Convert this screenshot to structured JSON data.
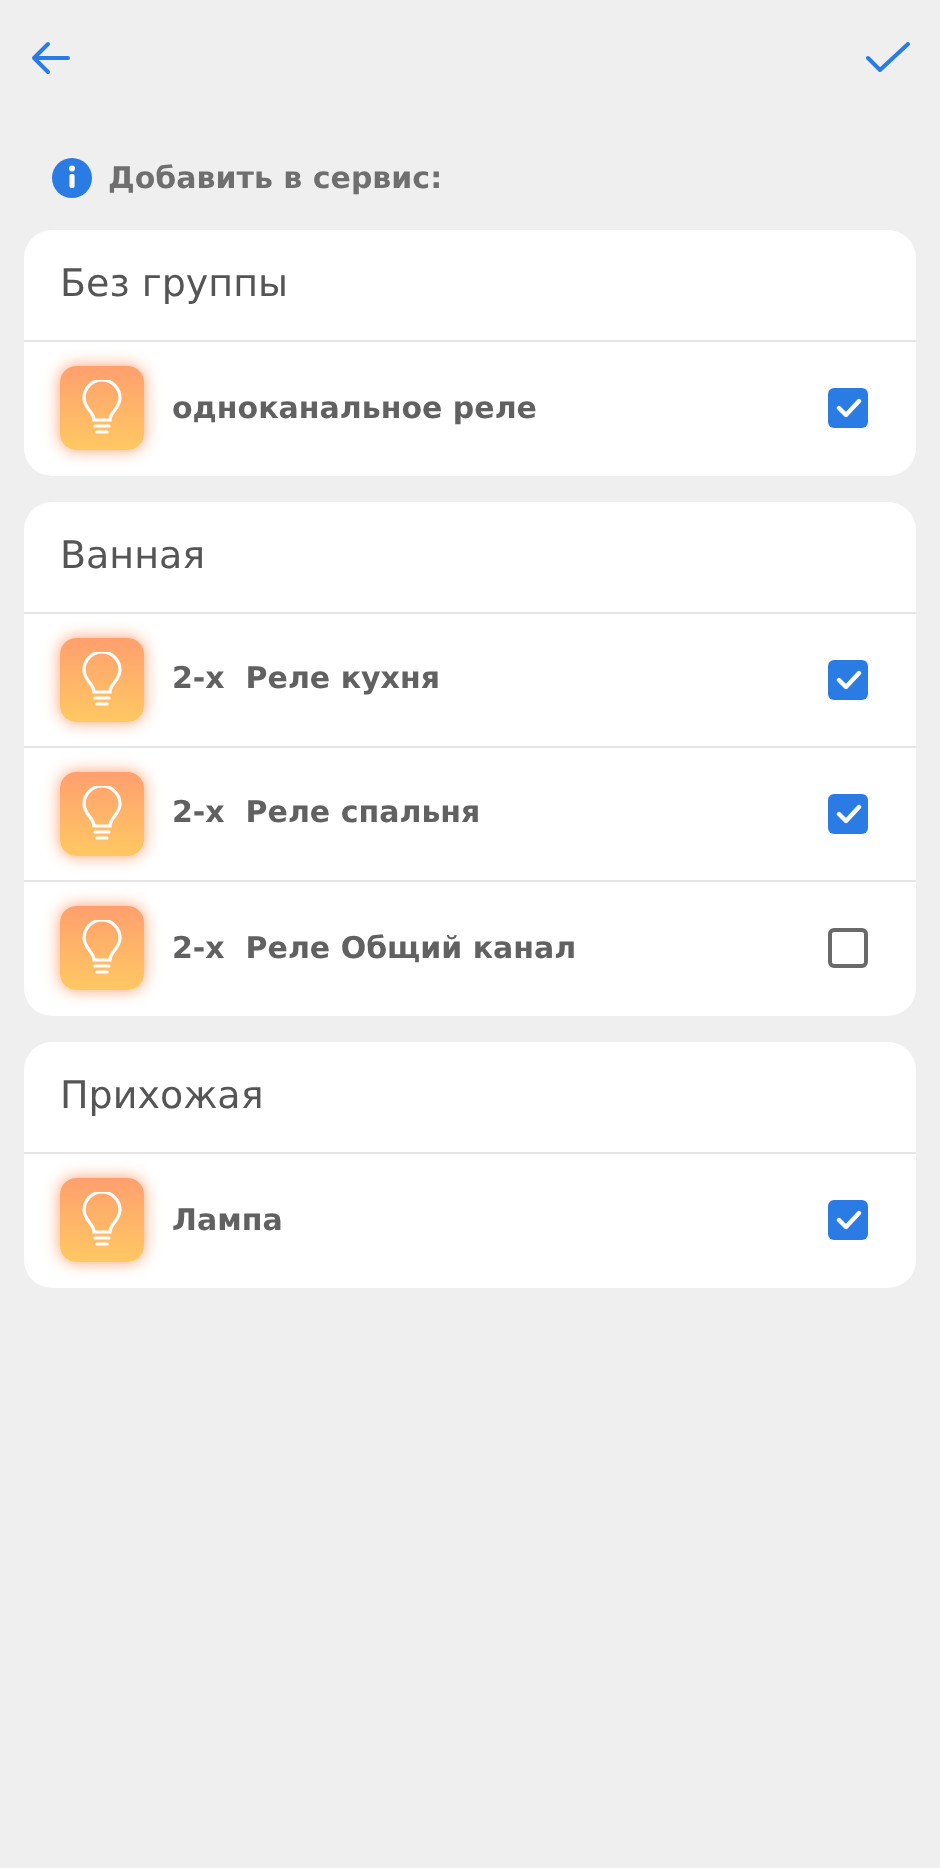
{
  "info": {
    "text": "Добавить в сервис:"
  },
  "groups": [
    {
      "title": "Без группы",
      "devices": [
        {
          "name": "одноканальное реле",
          "checked": true
        }
      ]
    },
    {
      "title": "Ванная",
      "devices": [
        {
          "name": "2-х  Реле кухня",
          "checked": true
        },
        {
          "name": "2-х  Реле спальня",
          "checked": true
        },
        {
          "name": "2-х  Реле Общий канал",
          "checked": false
        }
      ]
    },
    {
      "title": "Прихожая",
      "devices": [
        {
          "name": "Лампа",
          "checked": true
        }
      ]
    }
  ]
}
